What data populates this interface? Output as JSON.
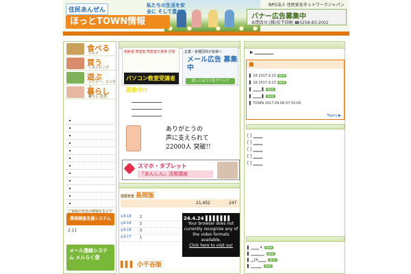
{
  "header": {
    "logo_tag": "住民あんぜん",
    "logo_main": "ほっとTOWN情報",
    "tagline": "私たちの生活を安全に そして豊かに",
    "npo": "NPO法人 住民安全ネットワークジャパン",
    "banner_title": "バナー広告募集中",
    "banner_contact": "お問合せ:(株)位下印刷 ☎0258-83-2002"
  },
  "left_menu": [
    {
      "big": "食べる",
      "small": "グルメ",
      "color": "#c9a15b"
    },
    {
      "big": "買う",
      "small": "ショッピング",
      "color": "#d98c6a"
    },
    {
      "big": "遊ぶ",
      "small": "レジャー、エンタメ",
      "color": "#7fb05a"
    },
    {
      "big": "暮らし",
      "small": "暮らし-生活",
      "color": "#e7b8a0"
    }
  ],
  "left_extra": {
    "band_label": "業務調査支援システム",
    "band_caption": "ご家庭の安全の経験を生かす",
    "small_value": "2.11",
    "green_title": "メール連絡システム メルらく便"
  },
  "middle": {
    "ad_left_label": "高齢者 障害者 障害者の家族 対象",
    "ad_left_title": "パソコン教室受講者募集中!!",
    "ad_right_tag": "企業・各種団体の皆様へ",
    "ad_right_title": "メール広告 募集中",
    "ad_right_button": "詳しくはココをクリック",
    "thanks_lines": [
      "ありがとうの",
      "声に支えられて",
      "22000人 突破!!"
    ],
    "smartphone_title": "スマホ・タブレット",
    "smartphone_sub": "「あんしん」活用講座",
    "region_pre": "住民安全",
    "region_title": "長岡版",
    "stat_1": "21,452",
    "stat_2": "247",
    "region_rows": [
      {
        "date": "◎9.18",
        "num": "2"
      },
      {
        "date": "◎9.18",
        "num": "2"
      },
      {
        "date": "◎9.18",
        "num": "3"
      },
      {
        "date": "◎9.17",
        "num": "1"
      }
    ],
    "video_title": "24.4.24 ▌▌▌▌▌▌▌",
    "video_msg": "Your browser does not currently recognize any of the video formats available.",
    "video_link": "Click here to visit our",
    "region_footer": "▌▌▌ 小千谷版"
  },
  "right": {
    "top_link": "▶ ▁▁▁▁▁▁",
    "entries": [
      {
        "text": "▌  18  2017.9.13",
        "badge": "NEW"
      },
      {
        "text": "▌  18  2017.9.13",
        "badge": "NEW"
      },
      {
        "text": "▌ ▁▁▁  ▌",
        "badge": "NEW"
      },
      {
        "text": "▌ ▁▁▁ ▌",
        "badge": "NEW"
      },
      {
        "text": "▌     TOWN  2017.09.08 07:55:00",
        "badge": ""
      }
    ],
    "topics": "Topics ▶",
    "list2": [
      "[  ] ▁▁▁",
      "[  ] ▁▁▁",
      "[  ] ▁▁▁",
      "[  ] ▁▁▁",
      "[  ] ▁▁▁"
    ],
    "list3": [
      {
        "text": "▌ ▁▁▁ 4",
        "badge": "NEW"
      },
      {
        "text": "▌ ▁▁▁▁▁",
        "badge": "NEW"
      },
      {
        "text": "▌ ▁24▁▁▁",
        "badge": "NEW"
      },
      {
        "text": "▌ ▁▁▁▁",
        "badge": "NEW"
      }
    ]
  },
  "colors": {
    "orange": "#e2760f",
    "green": "#6bb24a",
    "border": "#b7cf8a"
  }
}
